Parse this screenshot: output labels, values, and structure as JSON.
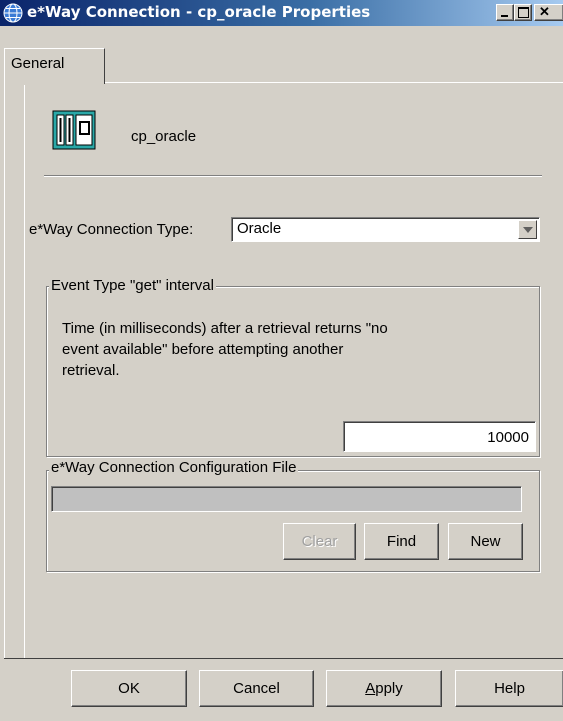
{
  "window": {
    "title": "e*Way Connection - cp_oracle Properties",
    "icon": "globe-icon",
    "controls": [
      "minimize",
      "maximize",
      "close"
    ]
  },
  "tabs": [
    {
      "label": "General",
      "selected": true
    }
  ],
  "general": {
    "connection_name": "cp_oracle",
    "connection_icon": "connection-icon",
    "type_label": "e*Way Connection Type:",
    "type_value": "Oracle",
    "interval_group": {
      "title": "Event Type \"get\" interval",
      "description_lines": [
        "Time (in milliseconds) after a retrieval returns \"no",
        "event available\" before attempting another",
        "retrieval."
      ],
      "value": "10000"
    },
    "config_group": {
      "title": "e*Way Connection Configuration File",
      "file_value": "",
      "buttons": {
        "clear": "Clear",
        "find": "Find",
        "new": "New"
      }
    }
  },
  "footer_buttons": {
    "ok": "OK",
    "cancel": "Cancel",
    "apply_prefix": "",
    "apply_accel": "A",
    "apply_rest": "pply",
    "help": "Help"
  }
}
